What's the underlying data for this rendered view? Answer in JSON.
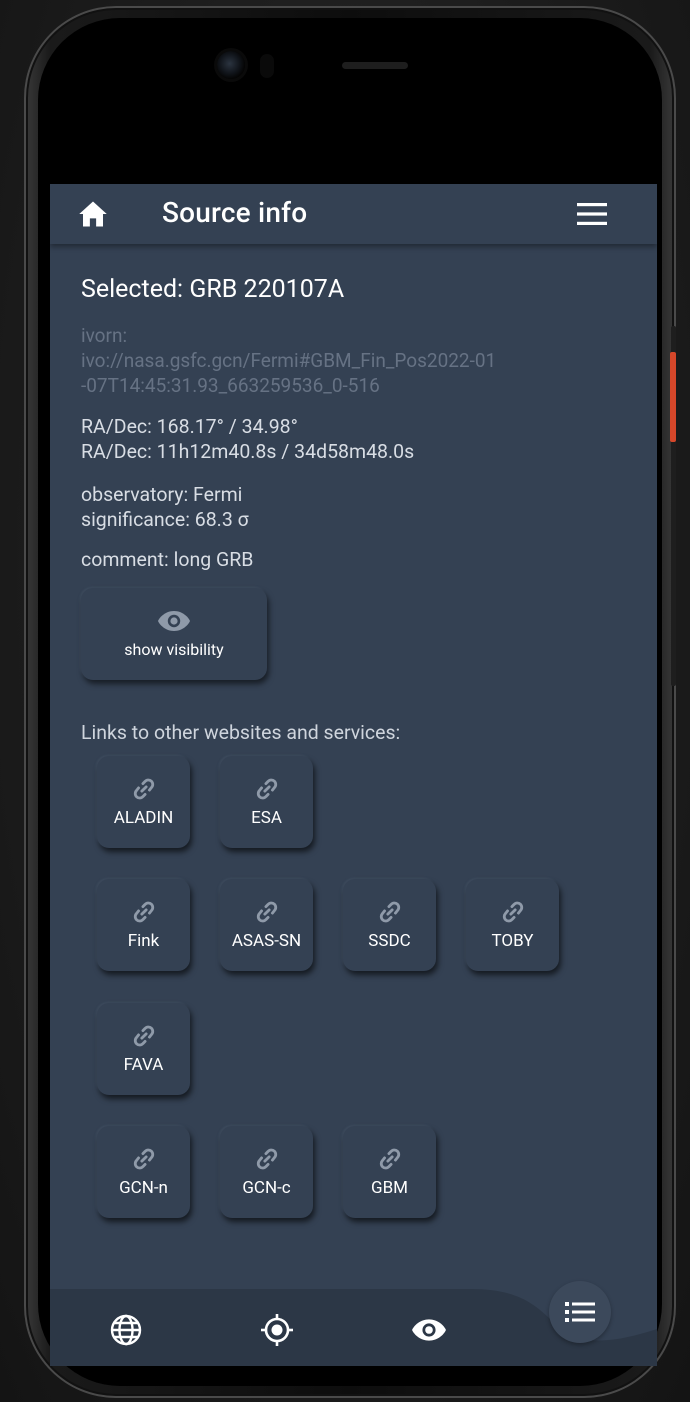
{
  "appbar": {
    "title": "Source info",
    "home_icon": "home-icon",
    "menu_icon": "hamburger-menu-icon"
  },
  "source": {
    "selected": "Selected: GRB 220107A",
    "ivorn_lines": [
      "ivorn:",
      "ivo://nasa.gsfc.gcn/Fermi#GBM_Fin_Pos2022-01",
      "-07T14:45:31.93_663259536_0-516"
    ],
    "radec_deg": "RA/Dec: 168.17° / 34.98°",
    "radec_hms": "RA/Dec: 11h12m40.8s / 34d58m48.0s",
    "observatory": "observatory: Fermi",
    "significance": "significance: 68.3 σ",
    "comment": "comment: long GRB"
  },
  "visibility_button": {
    "label": "show visibility",
    "icon": "eye-icon"
  },
  "links": {
    "label": "Links to other websites and services:",
    "rows": [
      [
        "ALADIN",
        "ESA"
      ],
      [
        "Fink",
        "ASAS-SN",
        "SSDC",
        "TOBY"
      ],
      [
        "FAVA"
      ],
      [
        "GCN-n",
        "GCN-c",
        "GBM"
      ]
    ],
    "icon": "link-icon"
  },
  "bottom_nav": {
    "items": [
      "globe-icon",
      "crosshair-icon",
      "eye-icon"
    ],
    "fab_icon": "list-icon"
  },
  "colors": {
    "background": "#344153",
    "bottom_bar": "#2c3746",
    "text": "#e6e9ee",
    "muted": "#667284"
  }
}
